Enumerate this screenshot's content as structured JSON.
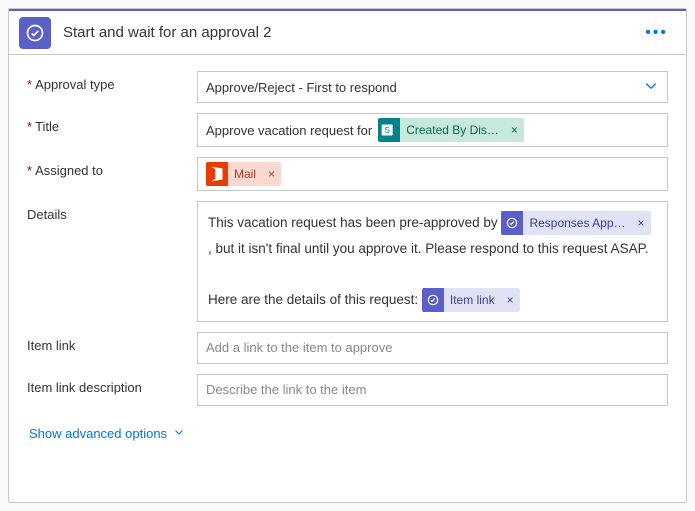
{
  "header": {
    "title": "Start and wait for an approval 2",
    "menu_label": "More options"
  },
  "labels": {
    "approval_type": "Approval type",
    "title": "Title",
    "assigned_to": "Assigned to",
    "details": "Details",
    "item_link": "Item link",
    "item_link_desc": "Item link description"
  },
  "fields": {
    "approval_type": {
      "value": "Approve/Reject - First to respond"
    },
    "title": {
      "text_before": "Approve vacation request for",
      "token": {
        "label": "Created By Dis…"
      }
    },
    "assigned_to": {
      "token": {
        "label": "Mail"
      }
    },
    "details": {
      "part1": "This vacation request has been pre-approved by ",
      "token1": {
        "label": "Responses App…"
      },
      "part2": ", but it isn't final until you approve it. Please respond to this request ASAP.",
      "part3": "Here are the details of this request:",
      "token2": {
        "label": "Item link"
      }
    },
    "item_link": {
      "placeholder": "Add a link to the item to approve"
    },
    "item_link_desc": {
      "placeholder": "Describe the link to the item"
    }
  },
  "advanced": {
    "label": "Show advanced options"
  },
  "glyphs": {
    "remove": "×"
  }
}
